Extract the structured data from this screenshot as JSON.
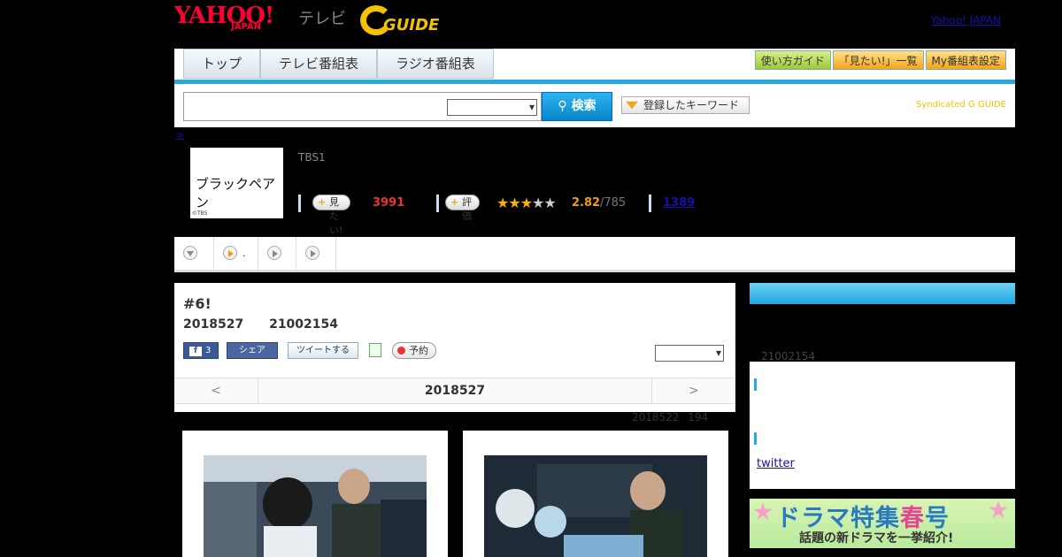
{
  "header": {
    "logo_yahoo": "YAHOO!",
    "logo_yahoo_sub": "JAPAN",
    "logo_tv": "テレビ",
    "logo_gguide": "G GUIDE",
    "yahoo_link": "Yahoo! JAPAN"
  },
  "nav": {
    "tabs": [
      "トップ",
      "テレビ番組表",
      "ラジオ番組表"
    ],
    "tools": [
      "使い方ガイド",
      "「見たい!」一覧",
      "My番組表設定"
    ],
    "search_placeholder": "",
    "search_button": "検索",
    "keyword_button": "登録したキーワード",
    "syndicated": "Syndicated G GUIDE"
  },
  "program": {
    "breadcrumb": ">",
    "thumb_title": "ブラックペアン",
    "thumb_copyright": "©TBS",
    "channel": "TBS1",
    "want_label": "見たい!",
    "want_count": "3991",
    "rate_label": "評価",
    "rating": "2.82",
    "rating_count": "/785",
    "link_count": "1389",
    "stars_on": 3,
    "stars_total": 5
  },
  "subtabs": [
    {
      "icon": "chevron-down-icon",
      "label": ""
    },
    {
      "icon": "play-orange-icon",
      "label": "."
    },
    {
      "icon": "play-icon",
      "label": ""
    },
    {
      "icon": "play-icon",
      "label": ""
    }
  ],
  "episode": {
    "title": "#6!",
    "date": "2018527",
    "time": "21002154",
    "fb_count": "3",
    "fb_share": "シェア",
    "tweet": "ツイートする",
    "reserve": "予約",
    "pager_prev": "<",
    "pager_current": "2018527",
    "pager_next": ">",
    "updated_date": "2018522",
    "updated_count": "194"
  },
  "side": {
    "time": "21002154",
    "twitter": "twitter"
  },
  "banner": {
    "title_a": "ドラマ特集",
    "title_b": "春",
    "title_c": "号",
    "subtitle": "話題の新ドラマを一挙紹介!"
  }
}
